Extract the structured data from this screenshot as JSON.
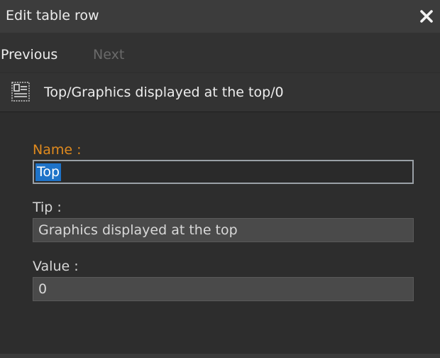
{
  "dialog": {
    "title": "Edit table row",
    "close_icon": "close-icon"
  },
  "nav": {
    "previous_label": "Previous",
    "next_label": "Next"
  },
  "row": {
    "icon": "table-row-icon",
    "path": "Top/Graphics displayed at the top/0"
  },
  "form": {
    "name_label": "Name :",
    "name_value": "Top",
    "tip_label": "Tip :",
    "tip_value": "Graphics displayed at the top",
    "value_label": "Value :",
    "value_value": "0"
  },
  "colors": {
    "active_label": "#e08a1e",
    "selection": "#1e73c8",
    "background": "#2d2d2d"
  }
}
